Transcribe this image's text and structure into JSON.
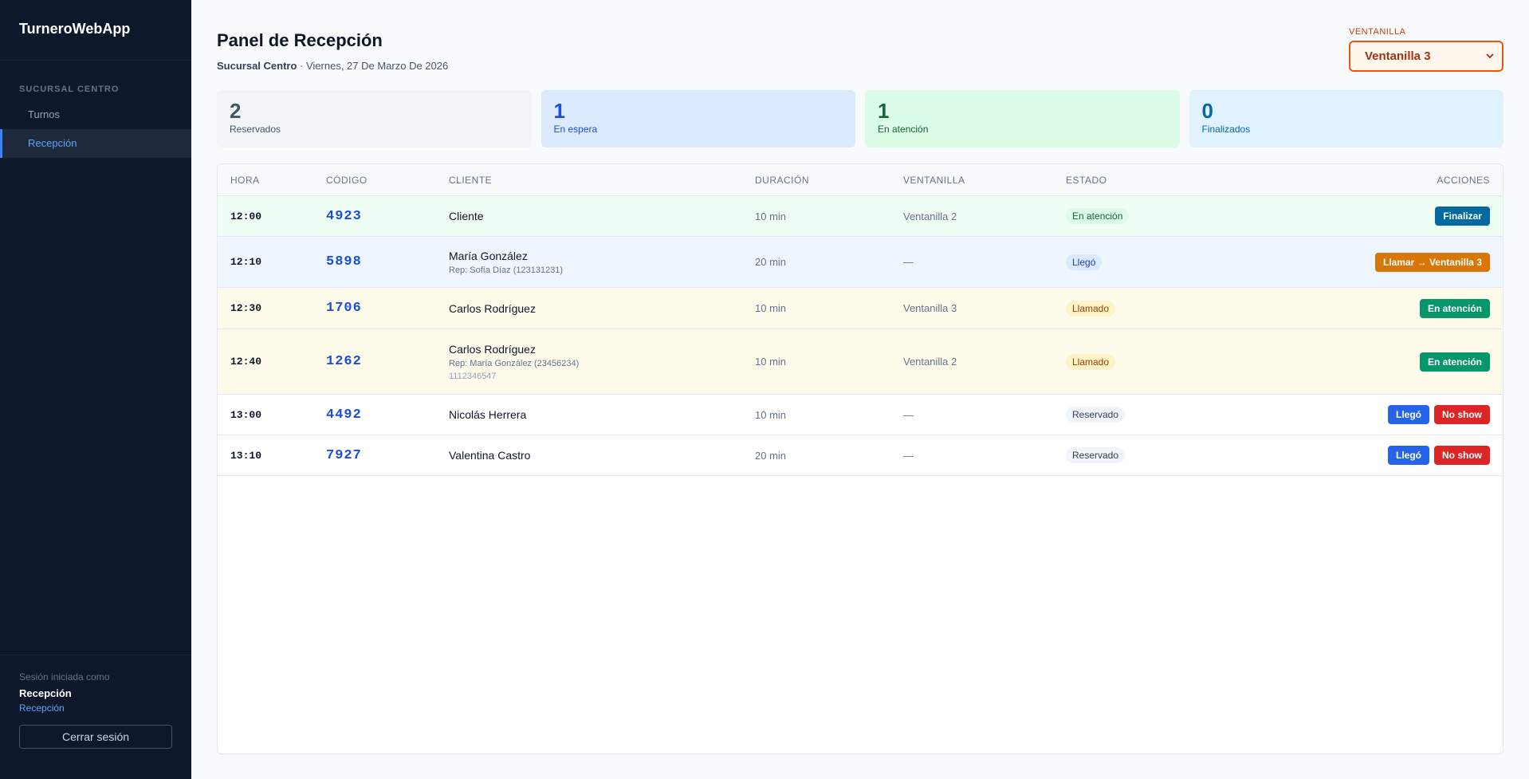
{
  "sidebar": {
    "brand": "TurneroWebApp",
    "section": "SUCURSAL CENTRO",
    "items": [
      {
        "label": "Turnos"
      },
      {
        "label": "Recepción"
      }
    ],
    "footer": {
      "session_label": "Sesión iniciada como",
      "user_name": "Recepción",
      "user_role": "Recepción",
      "logout_label": "Cerrar sesión"
    }
  },
  "header": {
    "title": "Panel de Recepción",
    "branch": "Sucursal Centro",
    "date": " · Viernes, 27 De Marzo De 2026",
    "window_label": "VENTANILLA",
    "window_selected": "Ventanilla 3"
  },
  "stats": [
    {
      "value": "2",
      "label": "Reservados"
    },
    {
      "value": "1",
      "label": "En espera"
    },
    {
      "value": "1",
      "label": "En atención"
    },
    {
      "value": "0",
      "label": "Finalizados"
    }
  ],
  "table": {
    "columns": [
      "HORA",
      "CÓDIGO",
      "CLIENTE",
      "DURACIÓN",
      "VENTANILLA",
      "ESTADO",
      "ACCIONES"
    ],
    "rows": [
      {
        "hora": "12:00",
        "codigo": "4923",
        "cliente": "Cliente",
        "rep": "",
        "phone": "",
        "duracion": "10 min",
        "ventanilla": "Ventanilla 2",
        "estado": "En atención",
        "acciones": [
          "Finalizar"
        ]
      },
      {
        "hora": "12:10",
        "codigo": "5898",
        "cliente": "María González",
        "rep": "Rep: Sofía Díaz (123131231)",
        "phone": "",
        "duracion": "20 min",
        "ventanilla": "—",
        "estado": "Llegó",
        "acciones": [
          "Llamar → Ventanilla 3"
        ]
      },
      {
        "hora": "12:30",
        "codigo": "1706",
        "cliente": "Carlos Rodríguez",
        "rep": "",
        "phone": "",
        "duracion": "10 min",
        "ventanilla": "Ventanilla 3",
        "estado": "Llamado",
        "acciones": [
          "En atención"
        ]
      },
      {
        "hora": "12:40",
        "codigo": "1262",
        "cliente": "Carlos Rodríguez",
        "rep": "Rep: María González (23456234)",
        "phone": "1112346547",
        "duracion": "10 min",
        "ventanilla": "Ventanilla 2",
        "estado": "Llamado",
        "acciones": [
          "En atención"
        ]
      },
      {
        "hora": "13:00",
        "codigo": "4492",
        "cliente": "Nicolás Herrera",
        "rep": "",
        "phone": "",
        "duracion": "10 min",
        "ventanilla": "—",
        "estado": "Reservado",
        "acciones": [
          "Llegó",
          "No show"
        ]
      },
      {
        "hora": "13:10",
        "codigo": "7927",
        "cliente": "Valentina Castro",
        "rep": "",
        "phone": "",
        "duracion": "20 min",
        "ventanilla": "—",
        "estado": "Reservado",
        "acciones": [
          "Llegó",
          "No show"
        ]
      }
    ]
  },
  "colors": {
    "sidebar_bg": "#0f172a",
    "accent": "#3b82f6",
    "window_accent": "#ea580c"
  }
}
